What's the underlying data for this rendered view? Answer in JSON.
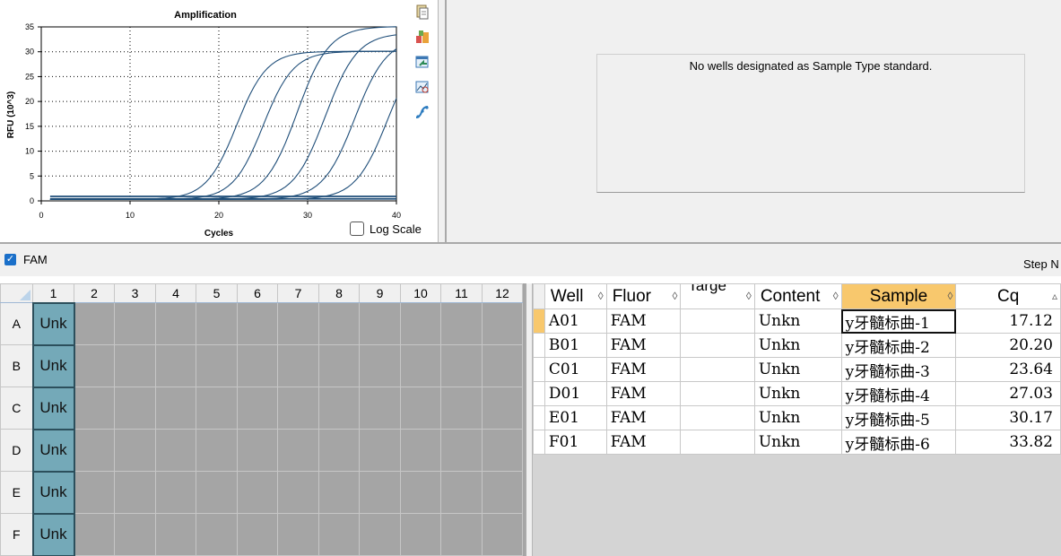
{
  "chart": {
    "title": "Amplification",
    "xlabel": "Cycles",
    "ylabel": "RFU (10^3)",
    "log_scale_label": "Log Scale",
    "toolbar_icons": [
      "copy-icon",
      "export-icon",
      "refresh-icon",
      "zoom-chart-icon",
      "curve-icon"
    ]
  },
  "chart_data": {
    "type": "line",
    "title": "Amplification",
    "xlabel": "Cycles",
    "ylabel": "RFU (10^3)",
    "xlim": [
      0,
      40
    ],
    "ylim": [
      0,
      35
    ],
    "xticks": [
      0,
      10,
      20,
      30,
      40
    ],
    "yticks": [
      0,
      5,
      10,
      15,
      20,
      25,
      30,
      35
    ],
    "grid": true,
    "line_color": "#1f4e79",
    "series": [
      {
        "cq": 17.12,
        "plateau": 29.8,
        "midpoint": 22.0,
        "slope": 1.7
      },
      {
        "cq": 20.2,
        "plateau": 29.8,
        "midpoint": 25.0,
        "slope": 1.7
      },
      {
        "cq": 23.64,
        "plateau": 34.8,
        "midpoint": 28.8,
        "slope": 1.8
      },
      {
        "cq": 27.03,
        "plateau": 33.5,
        "midpoint": 32.0,
        "slope": 1.8
      },
      {
        "cq": 30.17,
        "plateau": 32.5,
        "midpoint": 35.3,
        "slope": 1.8
      },
      {
        "cq": 33.82,
        "plateau": 32.0,
        "midpoint": 39.0,
        "slope": 1.8
      }
    ],
    "baseline_levels": [
      0.4,
      0.9
    ]
  },
  "std_curve": {
    "message": "No wells designated as Sample Type standard."
  },
  "fluor": {
    "label": "FAM",
    "checked": true,
    "step_label": "Step N"
  },
  "plate": {
    "columns": [
      "1",
      "2",
      "3",
      "4",
      "5",
      "6",
      "7",
      "8",
      "9",
      "10",
      "11",
      "12"
    ],
    "rows": [
      "A",
      "B",
      "C",
      "D",
      "E",
      "F"
    ],
    "well_label": "Unk"
  },
  "table": {
    "headers": {
      "well": "Well",
      "fluor": "Fluor",
      "target": "Targe",
      "content": "Content",
      "sample": "Sample",
      "cq": "Cq"
    },
    "rows": [
      {
        "well": "A01",
        "fluor": "FAM",
        "target": "",
        "content": "Unkn",
        "sample": "y牙髓标曲-1",
        "cq": "17.12"
      },
      {
        "well": "B01",
        "fluor": "FAM",
        "target": "",
        "content": "Unkn",
        "sample": "y牙髓标曲-2",
        "cq": "20.20"
      },
      {
        "well": "C01",
        "fluor": "FAM",
        "target": "",
        "content": "Unkn",
        "sample": "y牙髓标曲-3",
        "cq": "23.64"
      },
      {
        "well": "D01",
        "fluor": "FAM",
        "target": "",
        "content": "Unkn",
        "sample": "y牙髓标曲-4",
        "cq": "27.03"
      },
      {
        "well": "E01",
        "fluor": "FAM",
        "target": "",
        "content": "Unkn",
        "sample": "y牙髓标曲-5",
        "cq": "30.17"
      },
      {
        "well": "F01",
        "fluor": "FAM",
        "target": "",
        "content": "Unkn",
        "sample": "y牙髓标曲-6",
        "cq": "33.82"
      }
    ]
  }
}
